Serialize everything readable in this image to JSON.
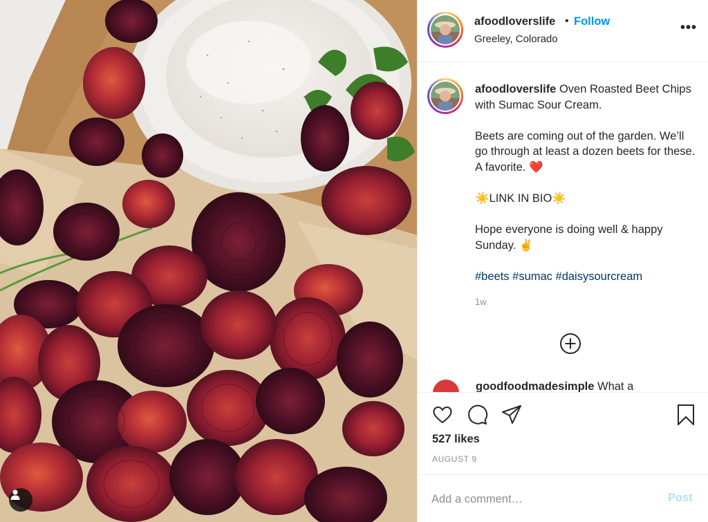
{
  "post": {
    "image_description_icon": "beet-chips-photo",
    "author": {
      "username": "afoodloverslife",
      "location": "Greeley, Colorado",
      "follow_label": "Follow",
      "dot": "•"
    },
    "more_options_label": "•••",
    "caption": {
      "username": "afoodloverslife",
      "line1": " Oven Roasted Beet Chips with Sumac Sour Cream.",
      "line2": "Beets are coming out of the garden. We’ll go through at least a dozen beets for these. A favorite. ❤️",
      "line3": "☀️LINK IN BIO☀️",
      "line4": "Hope everyone is doing well & happy Sunday. ✌️",
      "hashtags": [
        "#beets",
        "#sumac",
        "#daisysourcream"
      ],
      "age": "1w"
    },
    "next_comment": {
      "username": "goodfoodmadesimple",
      "text": " What a"
    },
    "likes": "527 likes",
    "date": "AUGUST 9",
    "comment_placeholder": "Add a comment…",
    "post_label": "Post",
    "colors": {
      "link_blue": "#0095f6",
      "hashtag": "#00376b",
      "post_disabled": "#b2dffc",
      "muted": "#8e8e8e"
    }
  }
}
